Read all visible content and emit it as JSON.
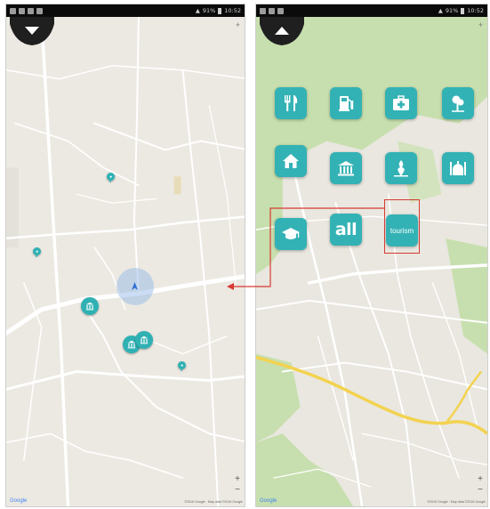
{
  "left_screen": {
    "status_time": "10:52",
    "status_battery": "91%",
    "zoom_top": "+",
    "zoom_in": "+",
    "zoom_out": "−",
    "google_logo": "Google",
    "attribution": "©2016 Google · Map data ©2016 Google",
    "pins": [
      {
        "icon": "pin-icon"
      },
      {
        "icon": "pin-icon"
      },
      {
        "icon": "museum-icon"
      },
      {
        "icon": "museum-icon"
      },
      {
        "icon": "museum-icon"
      },
      {
        "icon": "pin-icon"
      }
    ]
  },
  "right_screen": {
    "status_time": "10:52",
    "status_battery": "91%",
    "zoom_top": "+",
    "zoom_in": "+",
    "zoom_out": "−",
    "google_logo": "Google",
    "attribution": "©2016 Google · Map data ©2016 Google",
    "categories": [
      {
        "id": "restaurant",
        "icon": "fork-knife-icon"
      },
      {
        "id": "gas-station",
        "icon": "fuel-pump-icon"
      },
      {
        "id": "hospital",
        "icon": "medical-kit-icon"
      },
      {
        "id": "park",
        "icon": "tree-icon"
      },
      {
        "id": "hotel",
        "icon": "house-icon"
      },
      {
        "id": "museum",
        "icon": "museum-icon"
      },
      {
        "id": "shopping",
        "icon": "shopping-icon"
      },
      {
        "id": "mosque",
        "icon": "mosque-icon"
      },
      {
        "id": "education",
        "icon": "graduation-cap-icon"
      },
      {
        "id": "all",
        "label": "all"
      },
      {
        "id": "tourism",
        "label": "tourism"
      }
    ]
  },
  "colors": {
    "teal": "#33b2b5",
    "highlight": "#d63a32",
    "map_land": "#ece9e2",
    "map_green": "#c7dfae",
    "map_road_yellow": "#f3d24f"
  }
}
